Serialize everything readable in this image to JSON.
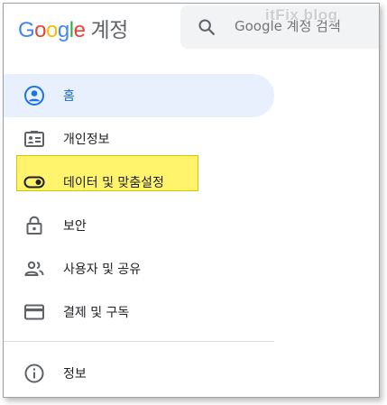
{
  "header": {
    "logo_google": "Google",
    "logo_suffix": "계정",
    "search": {
      "placeholder": "Google 계정 검색",
      "value": ""
    }
  },
  "watermark": "itFix blog",
  "nav": {
    "items": [
      {
        "label": "홈",
        "icon": "account-circle-icon",
        "active": true
      },
      {
        "label": "개인정보",
        "icon": "id-card-icon"
      },
      {
        "label": "데이터 및 맞춤설정",
        "icon": "toggle-icon",
        "highlighted": true
      },
      {
        "label": "보안",
        "icon": "lock-icon"
      },
      {
        "label": "사용자 및 공유",
        "icon": "people-icon"
      },
      {
        "label": "결제 및 구독",
        "icon": "credit-card-icon"
      }
    ],
    "footer_item": {
      "label": "정보",
      "icon": "info-icon"
    }
  },
  "colors": {
    "active_bg": "#e8f0fe",
    "active_text": "#1967d2",
    "highlight": "#fff46b"
  }
}
